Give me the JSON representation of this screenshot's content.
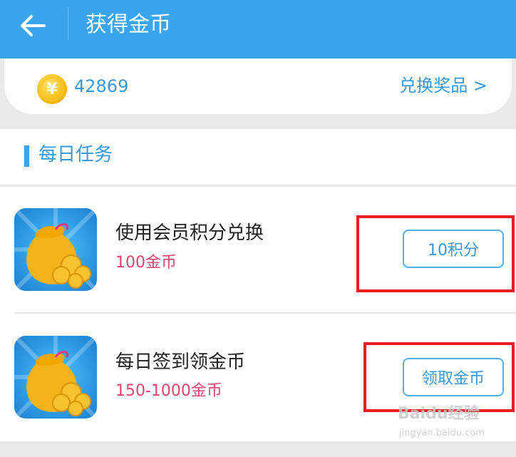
{
  "header": {
    "title": "获得金币",
    "back_icon": "arrow-left-icon",
    "background": "#3ba4ef"
  },
  "coins": {
    "icon": "coin-icon",
    "icon_glyph": "¥",
    "count": "42869",
    "redeem_label": "兑换奖品 >"
  },
  "section": {
    "title": "每日任务"
  },
  "tasks": [
    {
      "name": "使用会员积分兑换",
      "reward": "100金币",
      "button": "10积分",
      "icon": "coin-bag-icon"
    },
    {
      "name": "每日签到领金币",
      "reward": "150-1000金币",
      "button": "领取金币",
      "icon": "coin-bag-icon"
    }
  ],
  "watermark": {
    "text": "Baidu经验",
    "sub": "jingyan.baidu.com"
  },
  "colors": {
    "accent": "#3ba4ef",
    "reward": "#e1466e",
    "highlight": "#ec1c24"
  }
}
